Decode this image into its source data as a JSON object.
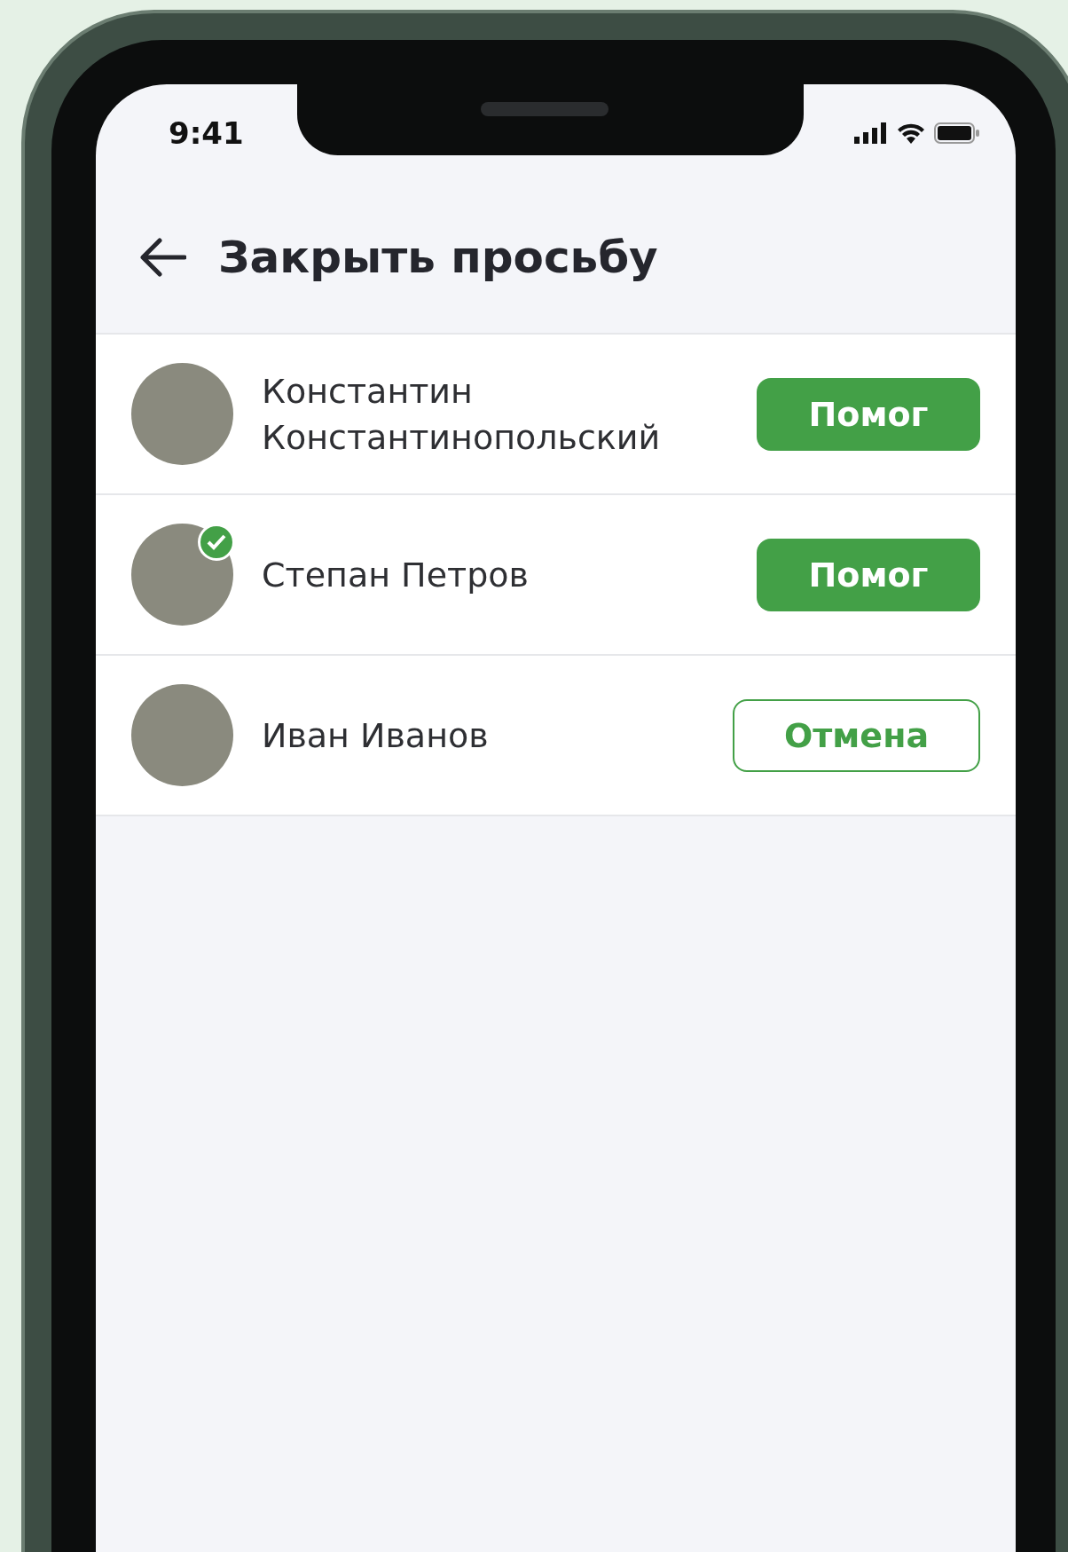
{
  "status_bar": {
    "time": "9:41"
  },
  "header": {
    "title": "Закрыть просьбу"
  },
  "helpers": [
    {
      "name": "Константин Константинопольский",
      "verified": false,
      "action": {
        "label": "Помог",
        "kind": "filled"
      }
    },
    {
      "name": "Степан Петров",
      "verified": true,
      "action": {
        "label": "Помог",
        "kind": "filled"
      }
    },
    {
      "name": "Иван Иванов",
      "verified": false,
      "action": {
        "label": "Отмена",
        "kind": "outline"
      }
    }
  ]
}
